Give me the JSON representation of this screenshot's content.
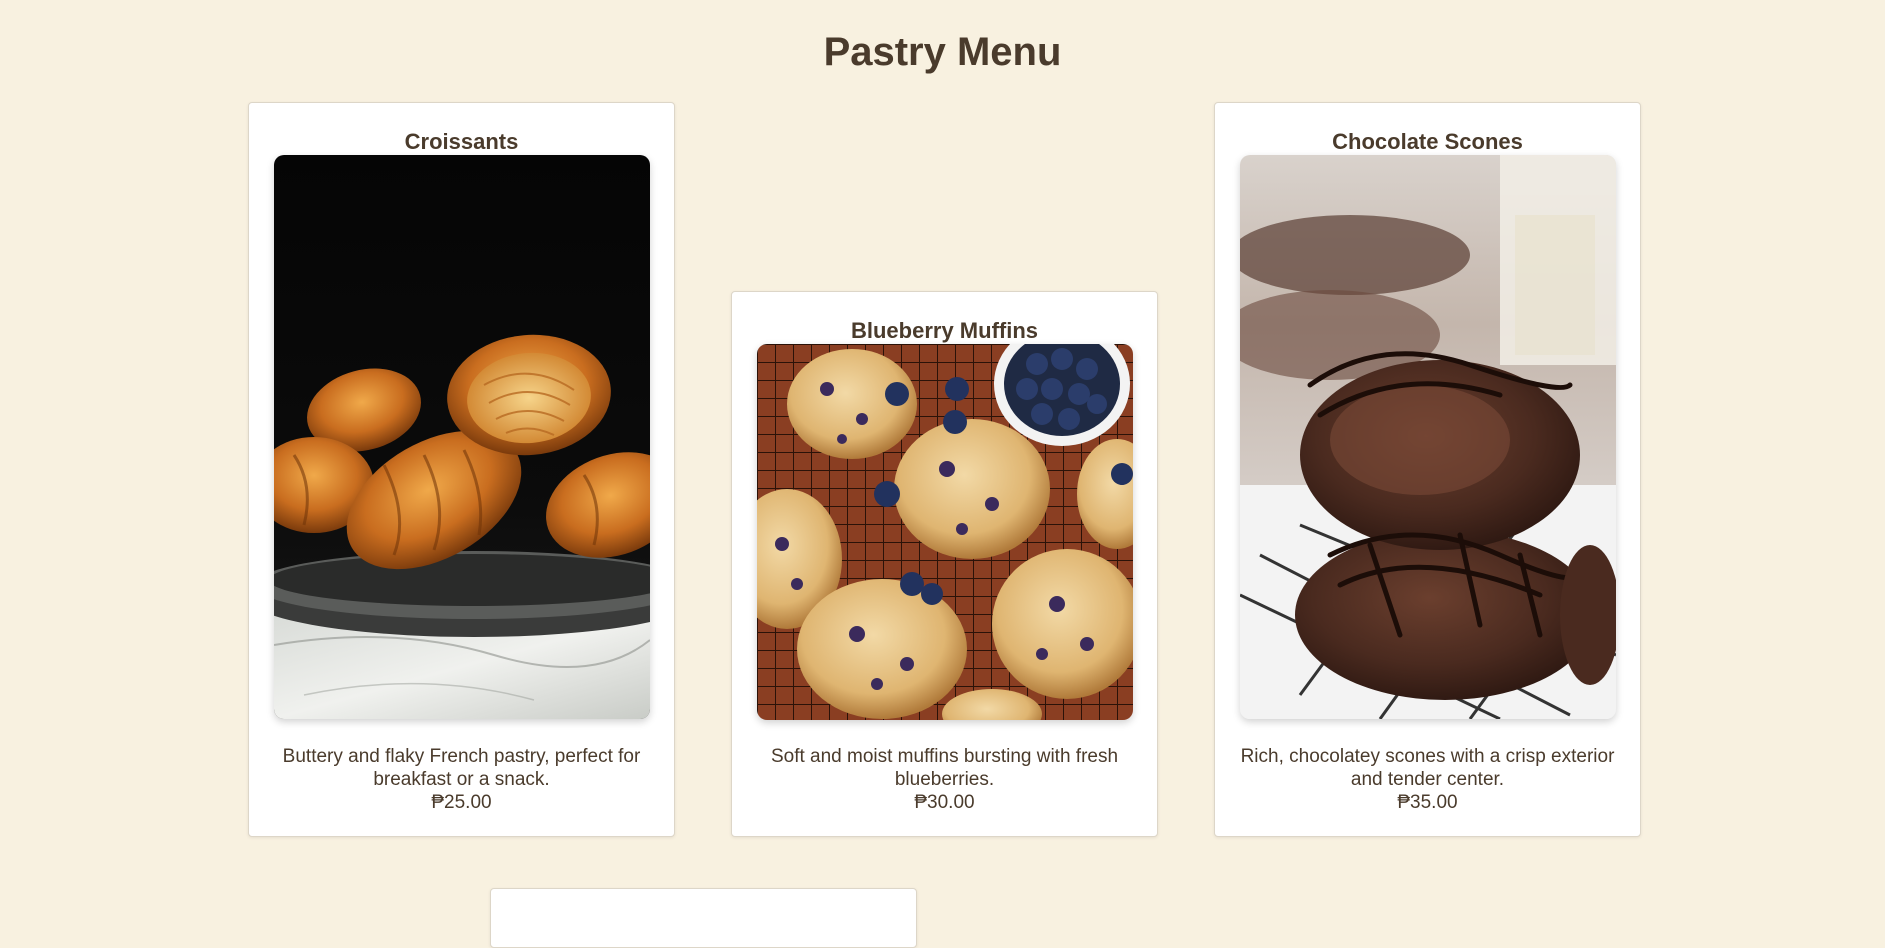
{
  "page": {
    "title": "Pastry Menu"
  },
  "items": [
    {
      "name": "Croissants",
      "description": "Buttery and flaky French pastry, perfect for breakfast or a snack.",
      "price": "₱25.00",
      "image_icon": "croissant-photo"
    },
    {
      "name": "Blueberry Muffins",
      "description": "Soft and moist muffins bursting with fresh blueberries.",
      "price": "₱30.00",
      "image_icon": "blueberry-muffin-photo"
    },
    {
      "name": "Chocolate Scones",
      "description": "Rich, chocolatey scones with a crisp exterior and tender center.",
      "price": "₱35.00",
      "image_icon": "chocolate-scone-photo"
    }
  ],
  "colors": {
    "background": "#f8f1e0",
    "card": "#ffffff",
    "text": "#4a3b2c"
  }
}
